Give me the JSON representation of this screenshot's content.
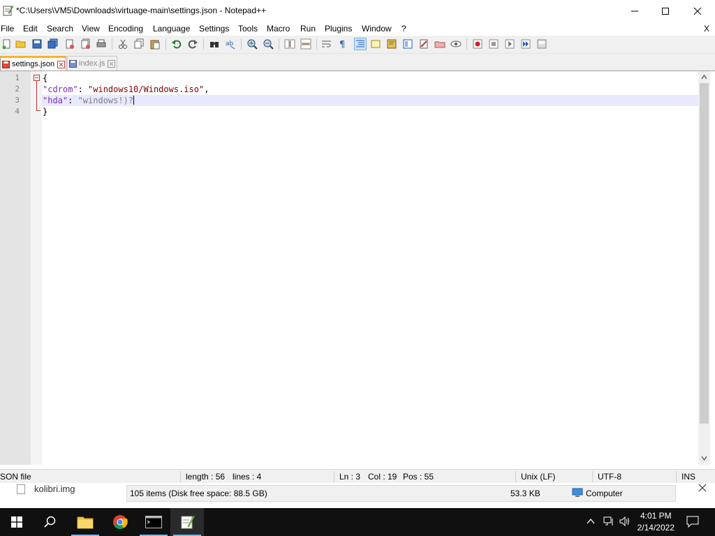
{
  "window": {
    "title": "*C:\\Users\\VM5\\Downloads\\virtuage-main\\settings.json - Notepad++"
  },
  "menu": {
    "items": [
      "File",
      "Edit",
      "Search",
      "View",
      "Encoding",
      "Language",
      "Settings",
      "Tools",
      "Macro",
      "Run",
      "Plugins",
      "Window",
      "?"
    ],
    "close_label": "X"
  },
  "tabs": [
    {
      "label": "settings.json",
      "active": true
    },
    {
      "label": "index.js",
      "active": false
    }
  ],
  "editor": {
    "line_numbers": [
      "1",
      "2",
      "3",
      "4"
    ],
    "lines": {
      "l1": "{",
      "l2_key": "\"cdrom\"",
      "l2_colon": ": ",
      "l2_val": "\"windows10/Windows.iso\"",
      "l2_comma": ",",
      "l3_key": "\"hda\"",
      "l3_colon": ": ",
      "l3_val": "\"windows!)?",
      "l4": "}"
    }
  },
  "status": {
    "file_type": "SON file",
    "length": "length : 56",
    "lines": "lines : 4",
    "ln": "Ln : 3",
    "col": "Col : 19",
    "pos": "Pos : 55",
    "eol": "Unix (LF)",
    "encoding": "UTF-8",
    "mode": "INS"
  },
  "explorer": {
    "file_item": "kolibri.img",
    "items_info": "105 items (Disk free space: 88.5 GB)",
    "size": "53.3 KB",
    "location": "Computer"
  },
  "taskbar": {
    "time": "4:01 PM",
    "date": "2/14/2022"
  },
  "colors": {
    "accent_tab": "#fab32a",
    "taskbar_bg": "#101010",
    "caret_line": "#e8e8ff"
  }
}
